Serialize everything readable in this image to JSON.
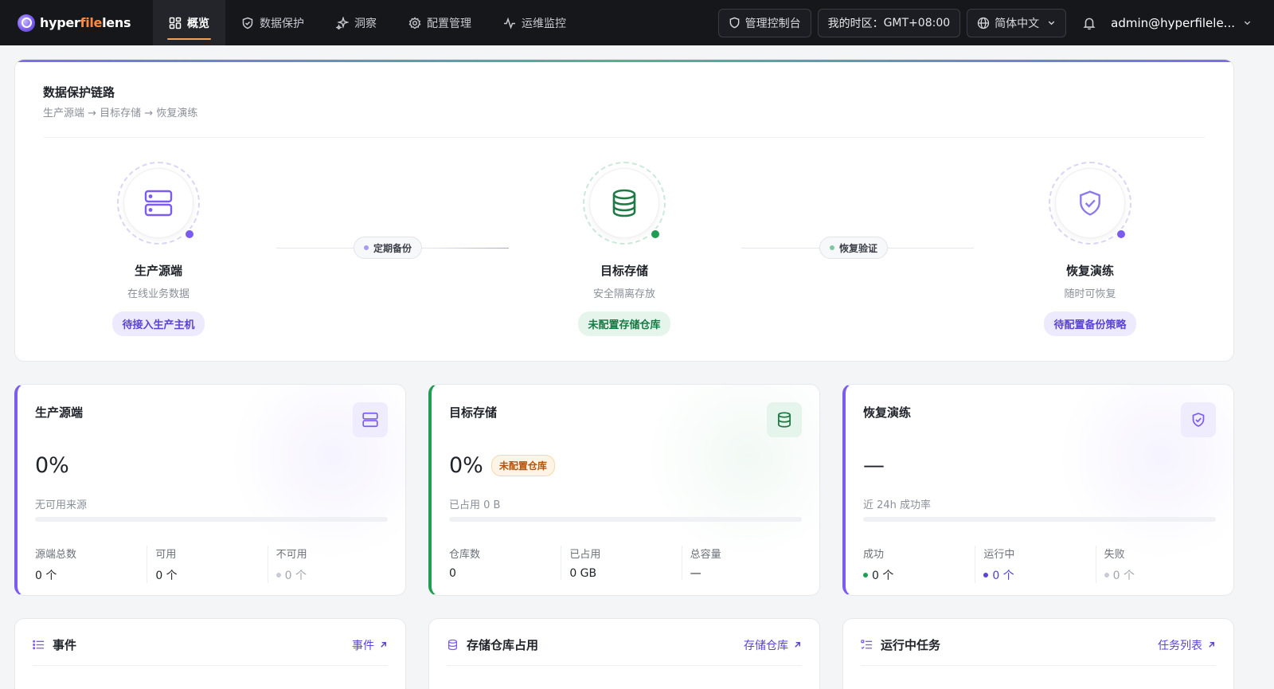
{
  "brand": {
    "part1": "hyper",
    "part2": "file",
    "part3": "lens"
  },
  "nav": {
    "items": [
      {
        "label": "概览",
        "icon": "dashboard-icon",
        "active": true
      },
      {
        "label": "数据保护",
        "icon": "shield-icon"
      },
      {
        "label": "洞察",
        "icon": "sparkle-icon"
      },
      {
        "label": "配置管理",
        "icon": "gear-icon"
      },
      {
        "label": "运维监控",
        "icon": "pulse-icon"
      }
    ]
  },
  "header": {
    "console_label": "管理控制台",
    "timezone_label": "我的时区：",
    "timezone_value": "GMT+08:00",
    "language": "简体中文",
    "user": "admin@hyperfilele..."
  },
  "chain": {
    "title": "数据保护链路",
    "subtitle": "生产源端 → 目标存储 → 恢复演练",
    "nodes": [
      {
        "title": "生产源端",
        "desc": "在线业务数据",
        "badge": "待接入生产主机",
        "icon": "server-icon",
        "color": "#7c5cf0"
      },
      {
        "title": "目标存储",
        "desc": "安全隔离存放",
        "badge": "未配置存储仓库",
        "icon": "database-icon",
        "color": "#1f9d55"
      },
      {
        "title": "恢复演练",
        "desc": "随时可恢复",
        "badge": "待配置备份策略",
        "icon": "shield-check-icon",
        "color": "#7c5cf0"
      }
    ],
    "links": [
      {
        "label": "定期备份",
        "dot_color": "#a99bf2"
      },
      {
        "label": "恢复验证",
        "dot_color": "#7cc9a0"
      }
    ]
  },
  "stats": {
    "source": {
      "title": "生产源端",
      "value": "0%",
      "caption": "无可用来源",
      "progress": 0,
      "metrics": [
        {
          "label": "源端总数",
          "value": "0 个"
        },
        {
          "label": "可用",
          "value": "0 个"
        },
        {
          "label": "不可用",
          "value": "0 个"
        }
      ]
    },
    "storage": {
      "title": "目标存储",
      "value": "0%",
      "tag": "未配置仓库",
      "caption": "已占用 0 B",
      "progress": 0,
      "metrics": [
        {
          "label": "仓库数",
          "value": "0"
        },
        {
          "label": "已占用",
          "value": "0 GB"
        },
        {
          "label": "总容量",
          "value": "—"
        }
      ]
    },
    "restore": {
      "title": "恢复演练",
      "value": "—",
      "caption": "近 24h 成功率",
      "progress": 0,
      "metrics": [
        {
          "label": "成功",
          "value": "0 个",
          "dot": "#1f9d55"
        },
        {
          "label": "运行中",
          "value": "0 个",
          "dot": "#5b43d6"
        },
        {
          "label": "失败",
          "value": "0 个",
          "dot": "#c8cbd1"
        }
      ]
    }
  },
  "panels": [
    {
      "title": "事件",
      "link": "事件",
      "icon": "list-icon"
    },
    {
      "title": "存储仓库占用",
      "link": "存储仓库",
      "icon": "database-icon"
    },
    {
      "title": "运行中任务",
      "link": "任务列表",
      "icon": "task-list-icon"
    }
  ]
}
